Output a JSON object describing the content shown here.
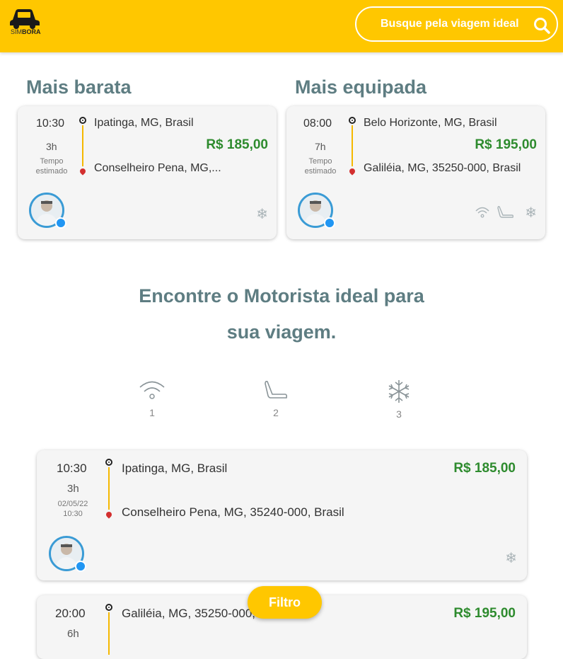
{
  "header": {
    "logo_text_light": "SIM",
    "logo_text_bold": "BORA",
    "search_label": "Busque pela viagem ideal"
  },
  "highlights": [
    {
      "title": "Mais barata",
      "time": "10:30",
      "duration": "3h",
      "estimate_label_1": "Tempo",
      "estimate_label_2": "estimado",
      "origin": "Ipatinga, MG, Brasil",
      "destination": "Conselheiro Pena, MG,...",
      "price": "R$ 185,00",
      "amenities": [
        "snowflake-icon"
      ]
    },
    {
      "title": "Mais equipada",
      "time": "08:00",
      "duration": "7h",
      "estimate_label_1": "Tempo",
      "estimate_label_2": "estimado",
      "origin": "Belo Horizonte, MG, Brasil",
      "destination": "Galiléia, MG, 35250-000, Brasil",
      "price": "R$ 195,00",
      "amenities": [
        "wifi-icon",
        "seat-icon",
        "snowflake-icon"
      ]
    }
  ],
  "headline": {
    "line1": "Encontre o Motorista ideal para",
    "line2": "sua viagem."
  },
  "filters": [
    {
      "icon": "wifi-icon",
      "count": "1"
    },
    {
      "icon": "seat-icon",
      "count": "2"
    },
    {
      "icon": "snowflake-icon",
      "count": "3"
    }
  ],
  "trips": [
    {
      "time": "10:30",
      "duration": "3h",
      "date": "02/05/22",
      "date_time": "10:30",
      "origin": "Ipatinga, MG, Brasil",
      "destination": "Conselheiro Pena, MG, 35240-000, Brasil",
      "price": "R$ 185,00"
    },
    {
      "time": "20:00",
      "duration": "6h",
      "origin": "Galiléia, MG, 35250-000, Brasil",
      "price": "R$ 195,00"
    }
  ],
  "fab_label": "Filtro",
  "colors": {
    "brand_yellow": "#FFC700",
    "price_green": "#2E8B2E",
    "title_teal": "#5e7d82"
  }
}
